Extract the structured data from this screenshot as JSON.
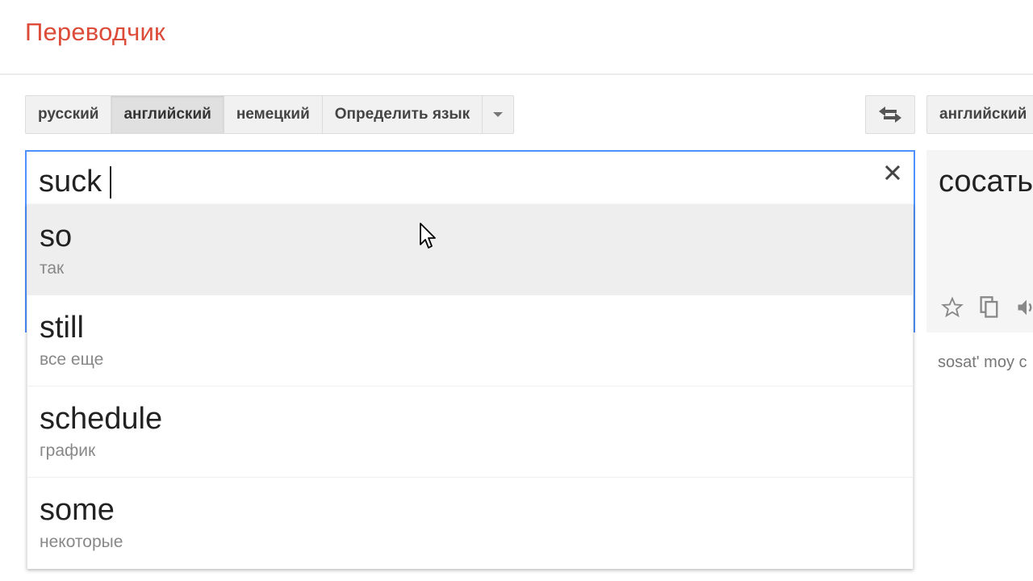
{
  "app": {
    "title": "Переводчик"
  },
  "source_languages": {
    "items": [
      {
        "label": "русский",
        "active": false
      },
      {
        "label": "английский",
        "active": true
      },
      {
        "label": "немецкий",
        "active": false
      },
      {
        "label": "Определить язык",
        "active": false
      }
    ]
  },
  "target_languages": {
    "selected": "английский"
  },
  "source": {
    "text": "suck"
  },
  "suggestions": [
    {
      "word": "so",
      "translation": "так",
      "highlighted": true
    },
    {
      "word": "still",
      "translation": "все еще",
      "highlighted": false
    },
    {
      "word": "schedule",
      "translation": "график",
      "highlighted": false
    },
    {
      "word": "some",
      "translation": "некоторые",
      "highlighted": false
    }
  ],
  "result": {
    "text": "сосать",
    "transliteration": "sosat' moy c"
  },
  "icons": {
    "dropdown": "chevron-down-icon",
    "swap": "swap-arrows-icon",
    "clear": "close-icon",
    "star": "star-icon",
    "copy": "copy-icon",
    "speaker": "speaker-icon",
    "pointer": "mouse-pointer-icon"
  },
  "colors": {
    "title": "#dd4b39",
    "focus_border": "#4d90fe",
    "highlight_row": "#eeeeee"
  }
}
